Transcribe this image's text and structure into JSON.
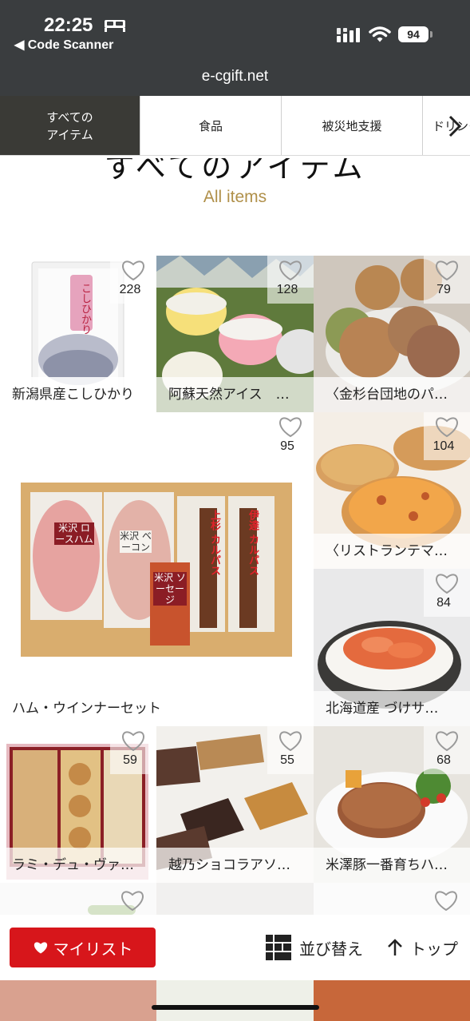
{
  "status": {
    "time": "22:25",
    "back_app": "◀ Code Scanner",
    "battery": "94"
  },
  "browser": {
    "url": "e-cgift.net"
  },
  "tabs": [
    {
      "label": "すべての\nアイテム",
      "active": true
    },
    {
      "label": "食品",
      "active": false
    },
    {
      "label": "被災地支援",
      "active": false
    },
    {
      "label": "ドリンク",
      "active": false
    }
  ],
  "section": {
    "title": "すべてのアイテム",
    "subtitle": "All items"
  },
  "products": [
    {
      "name": "新潟県産こしひかり",
      "favorites": "228",
      "package_text": "こしひかり"
    },
    {
      "name": "阿蘇天然アイス　…",
      "favorites": "128"
    },
    {
      "name": "〈金杉台団地のパ…",
      "favorites": "79"
    },
    {
      "name": "ハム・ウインナーセット",
      "favorites": "95",
      "package_texts": [
        "米沢 ロースハム",
        "米沢 ベーコン",
        "上杉 カルパス",
        "伊達 カルパス",
        "米沢 ソーセージ"
      ]
    },
    {
      "name": "〈リストランテマ…",
      "favorites": "104"
    },
    {
      "name": "北海道産 づけサ…",
      "favorites": "84"
    },
    {
      "name": "ラミ・デュ・ヴァ…",
      "favorites": "59"
    },
    {
      "name": "越乃ショコラアソ…",
      "favorites": "55"
    },
    {
      "name": "米澤豚一番育ちハ…",
      "favorites": "68"
    }
  ],
  "bottom_bar": {
    "mylist_label": "マイリスト",
    "sort_label": "並び替え",
    "top_label": "トップ"
  },
  "colors": {
    "header_bg": "#3a3d3f",
    "active_tab_bg": "#3a3a36",
    "subtitle_gold": "#b0904a",
    "mylist_red": "#d7161b"
  },
  "icons": [
    "bed-icon",
    "signal-icon",
    "wifi-icon",
    "chevron-right-icon",
    "heart-icon",
    "grid-icon",
    "arrow-up-icon"
  ]
}
